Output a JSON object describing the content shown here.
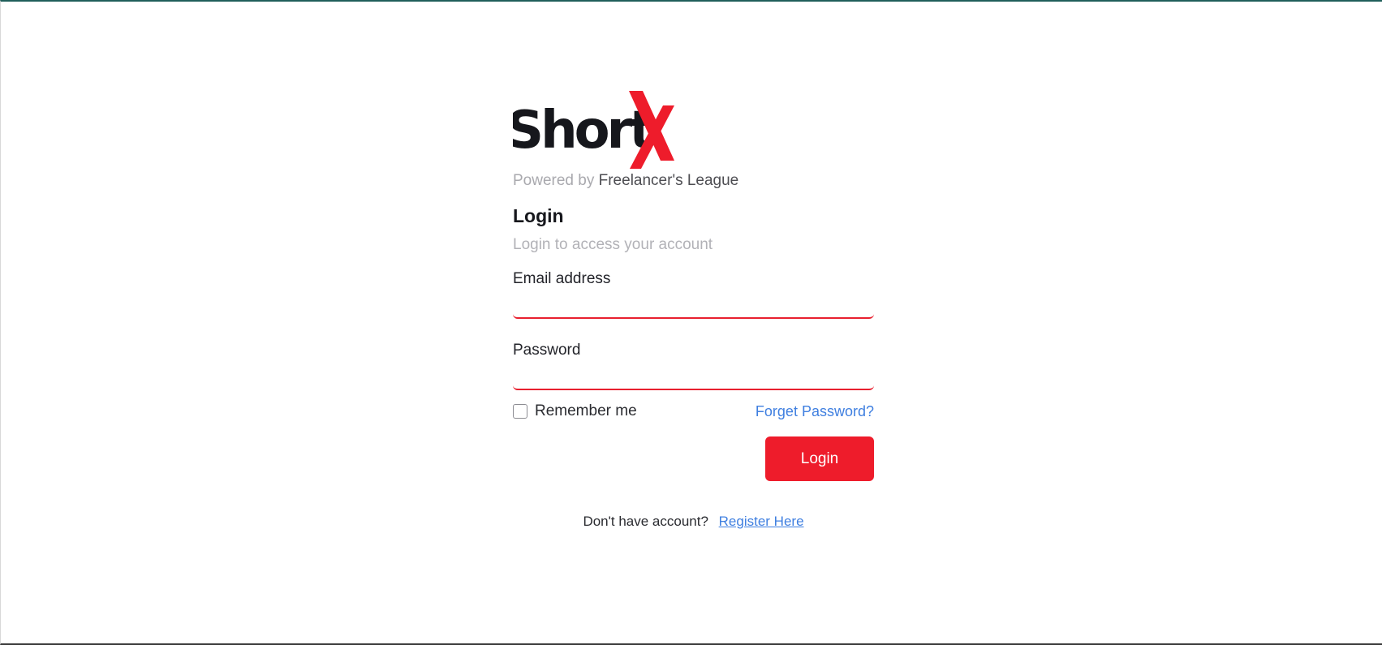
{
  "logo": {
    "text": "ShortX",
    "dark_color": "#16171c",
    "accent_color": "#ee1c2b"
  },
  "powered": {
    "prefix": "Powered by",
    "brand": "Freelancer's League"
  },
  "login": {
    "title": "Login",
    "subtitle": "Login to access your account"
  },
  "form": {
    "email_label": "Email address",
    "email_value": "",
    "password_label": "Password",
    "password_value": "",
    "remember_label": "Remember me",
    "remember_checked": false,
    "forgot_label": "Forget Password?",
    "submit_label": "Login"
  },
  "register": {
    "prompt": "Don't have account?",
    "link_label": "Register Here"
  }
}
